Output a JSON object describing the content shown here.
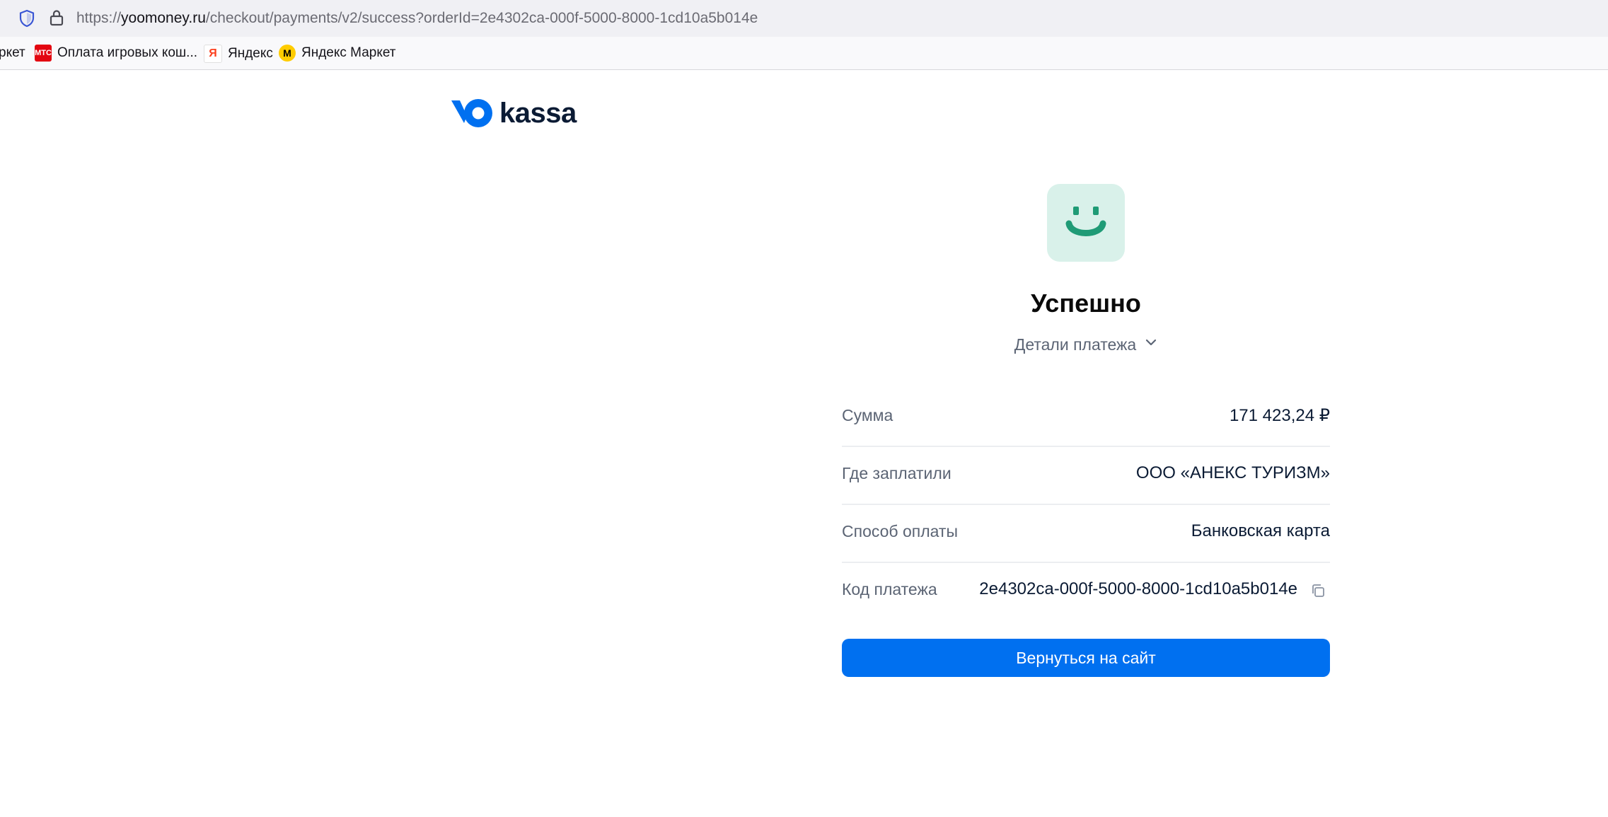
{
  "browser": {
    "url_prefix": "https://",
    "url_host": "yoomoney.ru",
    "url_path": "/checkout/payments/v2/success?orderId=2e4302ca-000f-5000-8000-1cd10a5b014e",
    "security_icon": "shield-icon",
    "lock_icon": "lock-icon",
    "bookmarks": [
      {
        "label": "ркет"
      },
      {
        "label": "Оплата игровых кош...",
        "icon": "mts-icon"
      },
      {
        "label": "Яндекс",
        "icon": "yandex-icon"
      },
      {
        "label": "Яндекс Маркет",
        "icon": "yandex-market-icon"
      }
    ]
  },
  "logo": {
    "text": "kassa",
    "mark": "yoo-logo"
  },
  "result": {
    "icon": "smile-icon",
    "title": "Успешно",
    "details_label": "Детали платежа",
    "details_icon": "chevron-down-icon"
  },
  "payment": {
    "rows": [
      {
        "label": "Сумма",
        "value": "171 423,24 ₽"
      },
      {
        "label": "Где заплатили",
        "value": "ООО «АНЕКС ТУРИЗМ»"
      },
      {
        "label": "Способ оплаты",
        "value": "Банковская карта"
      },
      {
        "label": "Код платежа",
        "value": "2e4302ca-000f-5000-8000-1cd10a5b014e",
        "action_icon": "copy-icon"
      }
    ]
  },
  "actions": {
    "return_label": "Вернуться на сайт"
  },
  "colors": {
    "accent": "#0070f0",
    "success_bg": "#d9f1ea",
    "success_fg": "#1f9b76",
    "brand_dark": "#0b1b34"
  }
}
